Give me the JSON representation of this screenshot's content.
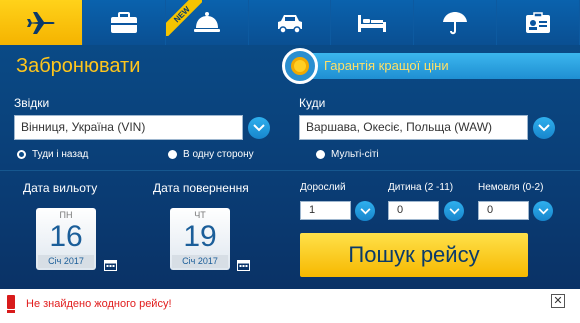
{
  "tabs": [
    {
      "icon": "airplane-icon",
      "active": true
    },
    {
      "icon": "briefcase-icon",
      "active": false
    },
    {
      "icon": "room-service-bell-icon",
      "active": false,
      "badge": "NEW"
    },
    {
      "icon": "car-icon",
      "active": false
    },
    {
      "icon": "bed-icon",
      "active": false
    },
    {
      "icon": "umbrella-icon",
      "active": false
    },
    {
      "icon": "contact-card-icon",
      "active": false
    }
  ],
  "header": {
    "title": "Забронювати",
    "guarantee": "Гарантія кращої ціни"
  },
  "route": {
    "from_label": "Звідки",
    "from_value": "Вінниця, Україна (VIN)",
    "to_label": "Куди",
    "to_value": "Варшава, Окесіє, Польща (WAW)"
  },
  "trip_type": [
    {
      "label": "Туди і назад",
      "selected": true
    },
    {
      "label": "В одну сторону",
      "selected": false
    },
    {
      "label": "Мульті-сіті",
      "selected": false
    }
  ],
  "dates": {
    "depart_label": "Дата вильоту",
    "depart": {
      "dow": "ПН",
      "day": "16",
      "month": "Січ 2017"
    },
    "return_label": "Дата повернення",
    "return": {
      "dow": "ЧТ",
      "day": "19",
      "month": "Січ 2017"
    }
  },
  "passengers": {
    "adult_label": "Дорослий",
    "adult_value": "1",
    "child_label": "Дитина (2 -11)",
    "child_value": "0",
    "infant_label": "Немовля (0-2)",
    "infant_value": "0"
  },
  "search_label": "Пошук рейсу",
  "error": {
    "message": "Не знайдено жодного рейсу!",
    "close_symbol": "✕"
  },
  "colors": {
    "accent_yellow": "#ffc61c",
    "panel_blue": "#0a4a86",
    "dropdown_blue": "#1f9ae0",
    "error_red": "#e11c1c"
  }
}
